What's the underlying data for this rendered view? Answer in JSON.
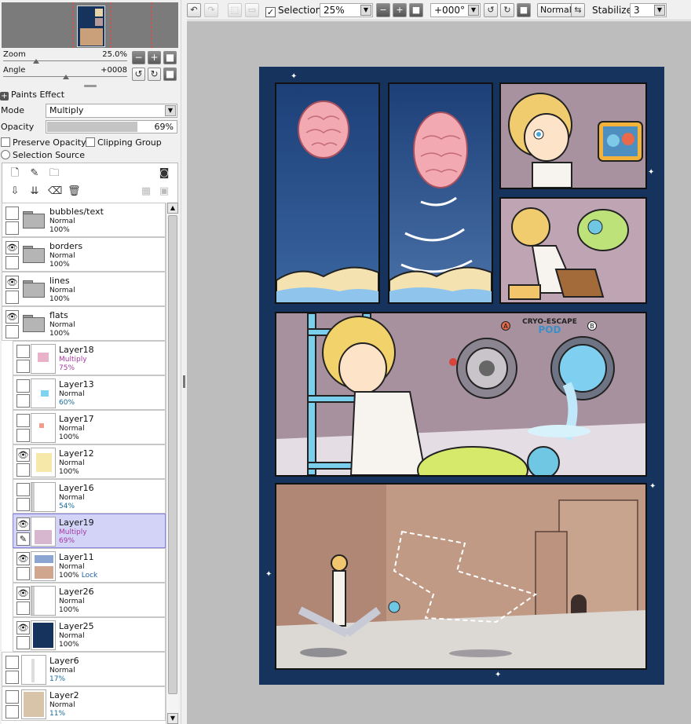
{
  "navigator": {
    "zoom_label": "Zoom",
    "zoom_value": "25.0%",
    "angle_label": "Angle",
    "angle_value": "+0008"
  },
  "paints_effect": {
    "label": "Paints Effect"
  },
  "layer_props": {
    "mode_label": "Mode",
    "mode_value": "Multiply",
    "opacity_label": "Opacity",
    "opacity_value": "69%",
    "opacity_fraction": 0.69,
    "preserve_opacity": "Preserve Opacity",
    "clipping_group": "Clipping Group",
    "selection_source": "Selection Source"
  },
  "layers": [
    {
      "name": "bubbles/text",
      "blend": "Normal",
      "opacity": "100%",
      "folder": true,
      "visible": false
    },
    {
      "name": "borders",
      "blend": "Normal",
      "opacity": "100%",
      "folder": true,
      "visible": true
    },
    {
      "name": "lines",
      "blend": "Normal",
      "opacity": "100%",
      "folder": true,
      "visible": true
    },
    {
      "name": "flats",
      "blend": "Normal",
      "opacity": "100%",
      "folder": true,
      "open": true,
      "visible": true
    },
    {
      "name": "Layer18",
      "blend": "Multiply",
      "opacity": "75%",
      "visible": false
    },
    {
      "name": "Layer13",
      "blend": "Normal",
      "opacity": "60%",
      "visible": false
    },
    {
      "name": "Layer17",
      "blend": "Normal",
      "opacity": "100%",
      "visible": false
    },
    {
      "name": "Layer12",
      "blend": "Normal",
      "opacity": "100%",
      "visible": true
    },
    {
      "name": "Layer16",
      "blend": "Normal",
      "opacity": "54%",
      "visible": false
    },
    {
      "name": "Layer19",
      "blend": "Multiply",
      "opacity": "69%",
      "visible": true,
      "selected": true
    },
    {
      "name": "Layer11",
      "blend": "Normal",
      "opacity": "100%",
      "lock": "Lock",
      "visible": true
    },
    {
      "name": "Layer26",
      "blend": "Normal",
      "opacity": "100%",
      "visible": true
    },
    {
      "name": "Layer25",
      "blend": "Normal",
      "opacity": "100%",
      "visible": true
    },
    {
      "name": "Layer6",
      "blend": "Normal",
      "opacity": "17%",
      "visible": false
    },
    {
      "name": "Layer2",
      "blend": "Normal",
      "opacity": "11%",
      "visible": false
    }
  ],
  "toolbar": {
    "selection_label": "Selection",
    "zoom_value": "25%",
    "angle_value": "+000°",
    "blend_btn": "Normal",
    "stabilizer_label": "Stabilizer",
    "stabilizer_value": "3"
  },
  "comic": {
    "sign_text": "CRYO-ESCAPE",
    "sign_text2": "POD",
    "sign_a": "A",
    "sign_b": "B"
  },
  "colors": {
    "page_bg": "#16335e",
    "selected_layer": "#d3d3f7",
    "multiply_text": "#a33aa0"
  }
}
